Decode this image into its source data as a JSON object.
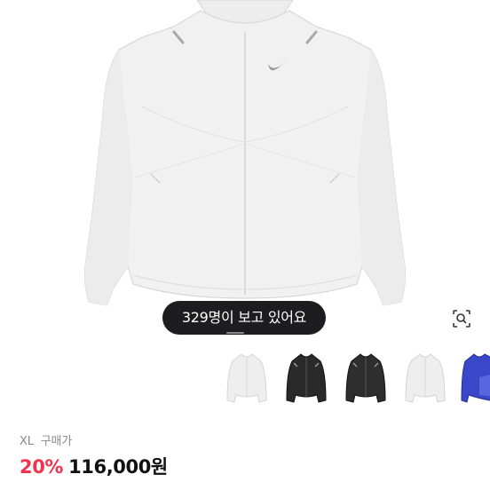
{
  "product": {
    "viewer_badge": "329명이 보고 있어요",
    "size_label": "XL",
    "purchase_label": "구매가",
    "discount": "20%",
    "price": "116,000원"
  },
  "icons": {
    "lens": "image-search-icon",
    "logo": "swoosh-logo"
  },
  "thumbnails": [
    {
      "variant": "white",
      "color": "#eeeeee",
      "selected": true
    },
    {
      "variant": "black",
      "color": "#2a2a2a",
      "selected": false
    },
    {
      "variant": "black",
      "color": "#2e2e2e",
      "selected": false
    },
    {
      "variant": "white",
      "color": "#eeeeee",
      "selected": false
    },
    {
      "variant": "blue",
      "color": "#3a47c8",
      "selected": false
    }
  ],
  "colors": {
    "accent": "#f1334d",
    "badge_bg": "#1d1d1f",
    "muted_text": "#8a8a8a"
  }
}
